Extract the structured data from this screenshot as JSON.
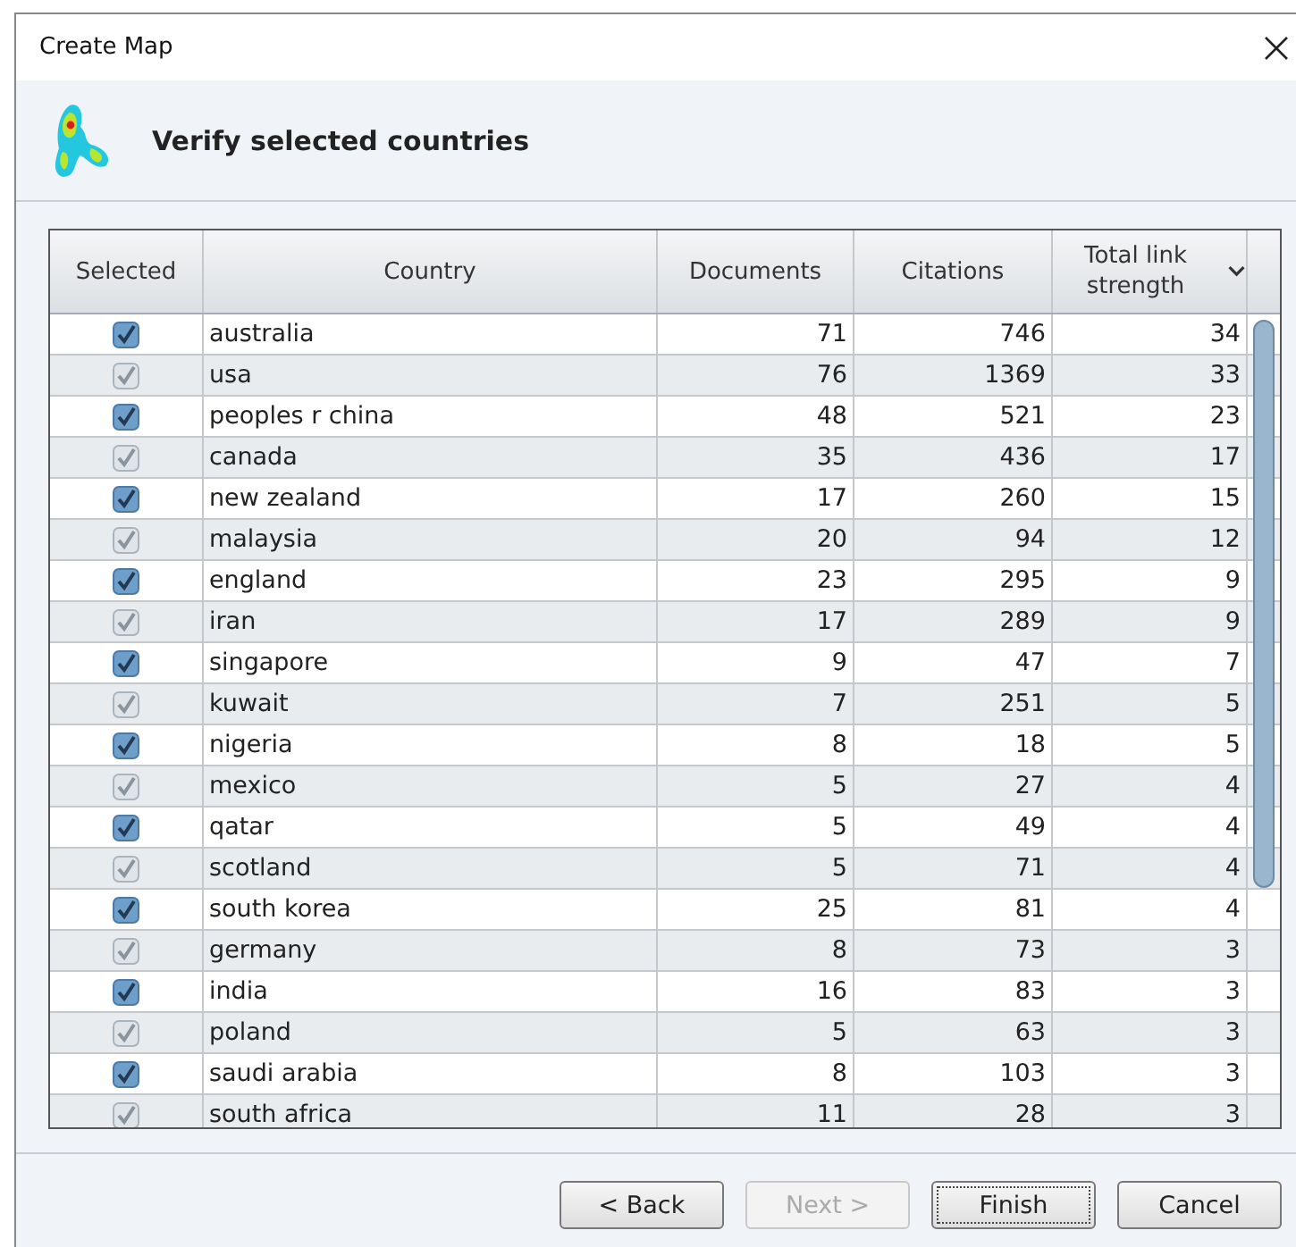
{
  "window": {
    "title": "Create Map"
  },
  "header": {
    "title": "Verify selected countries"
  },
  "table": {
    "columns": [
      {
        "label": "Selected",
        "sorted": false
      },
      {
        "label": "Country",
        "sorted": false
      },
      {
        "label": "Documents",
        "sorted": false
      },
      {
        "label": "Citations",
        "sorted": false
      },
      {
        "label": "Total link strength",
        "sorted": true
      }
    ],
    "rows": [
      {
        "checked": true,
        "country": "australia",
        "documents": "71",
        "citations": "746",
        "strength": "34"
      },
      {
        "checked": true,
        "country": "usa",
        "documents": "76",
        "citations": "1369",
        "strength": "33"
      },
      {
        "checked": true,
        "country": "peoples r china",
        "documents": "48",
        "citations": "521",
        "strength": "23"
      },
      {
        "checked": true,
        "country": "canada",
        "documents": "35",
        "citations": "436",
        "strength": "17"
      },
      {
        "checked": true,
        "country": "new zealand",
        "documents": "17",
        "citations": "260",
        "strength": "15"
      },
      {
        "checked": true,
        "country": "malaysia",
        "documents": "20",
        "citations": "94",
        "strength": "12"
      },
      {
        "checked": true,
        "country": "england",
        "documents": "23",
        "citations": "295",
        "strength": "9"
      },
      {
        "checked": true,
        "country": "iran",
        "documents": "17",
        "citations": "289",
        "strength": "9"
      },
      {
        "checked": true,
        "country": "singapore",
        "documents": "9",
        "citations": "47",
        "strength": "7"
      },
      {
        "checked": true,
        "country": "kuwait",
        "documents": "7",
        "citations": "251",
        "strength": "5"
      },
      {
        "checked": true,
        "country": "nigeria",
        "documents": "8",
        "citations": "18",
        "strength": "5"
      },
      {
        "checked": true,
        "country": "mexico",
        "documents": "5",
        "citations": "27",
        "strength": "4"
      },
      {
        "checked": true,
        "country": "qatar",
        "documents": "5",
        "citations": "49",
        "strength": "4"
      },
      {
        "checked": true,
        "country": "scotland",
        "documents": "5",
        "citations": "71",
        "strength": "4"
      },
      {
        "checked": true,
        "country": "south korea",
        "documents": "25",
        "citations": "81",
        "strength": "4"
      },
      {
        "checked": true,
        "country": "germany",
        "documents": "8",
        "citations": "73",
        "strength": "3"
      },
      {
        "checked": true,
        "country": "india",
        "documents": "16",
        "citations": "83",
        "strength": "3"
      },
      {
        "checked": true,
        "country": "poland",
        "documents": "5",
        "citations": "63",
        "strength": "3"
      },
      {
        "checked": true,
        "country": "saudi arabia",
        "documents": "8",
        "citations": "103",
        "strength": "3"
      },
      {
        "checked": true,
        "country": "south africa",
        "documents": "11",
        "citations": "28",
        "strength": "3"
      }
    ]
  },
  "buttons": [
    {
      "label": "< Back",
      "disabled": false,
      "focused": false
    },
    {
      "label": "Next >",
      "disabled": true,
      "focused": false
    },
    {
      "label": "Finish",
      "disabled": false,
      "focused": true
    },
    {
      "label": "Cancel",
      "disabled": false,
      "focused": false
    }
  ]
}
